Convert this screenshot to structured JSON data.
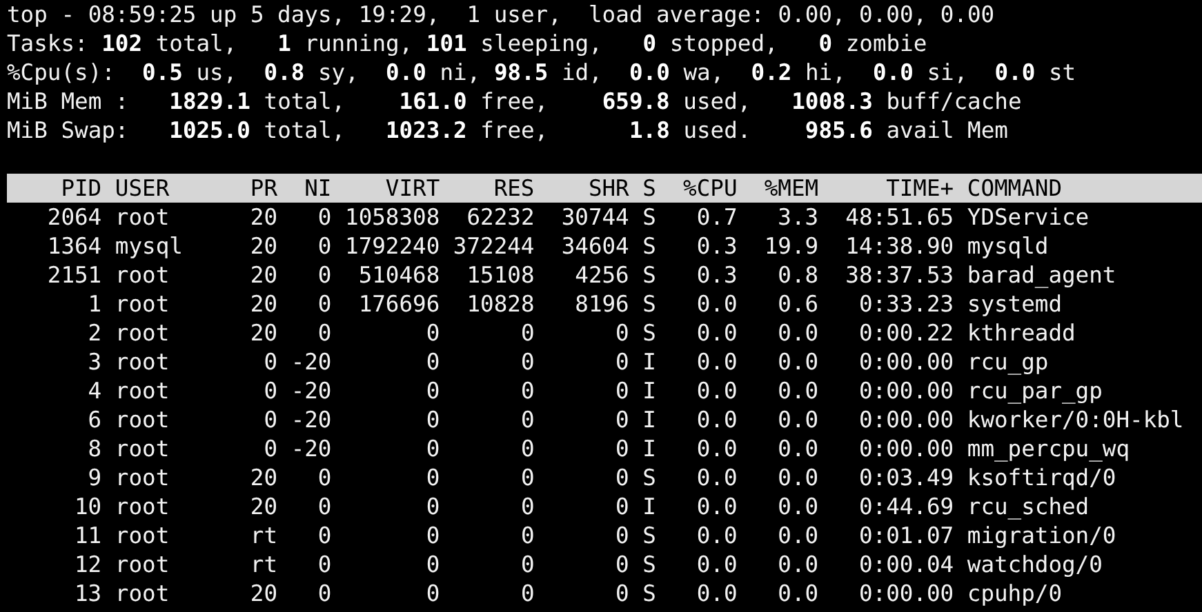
{
  "summary_lines": [
    "top - 08:59:25 up 5 days, 19:29,  1 user,  load average: 0.00, 0.00, 0.00",
    "Tasks: **102** total,   **1** running, **101** sleeping,   **0** stopped,   **0** zombie",
    "%Cpu(s):  **0.5** us,  **0.8** sy,  **0.0** ni, **98.5** id,  **0.0** wa,  **0.2** hi,  **0.0** si,  **0.0** st",
    "MiB Mem :   **1829.1** total,    **161.0** free,    **659.8** used,   **1008.3** buff/cache",
    "MiB Swap:   **1025.0** total,   **1023.2** free,      **1.8** used.    **985.6** avail Mem"
  ],
  "table": {
    "columns": [
      "PID",
      "USER",
      "PR",
      "NI",
      "VIRT",
      "RES",
      "SHR",
      "S",
      "%CPU",
      "%MEM",
      "TIME+",
      "COMMAND"
    ],
    "rows": [
      [
        "2064",
        "root",
        "20",
        "0",
        "1058308",
        "62232",
        "30744",
        "S",
        "0.7",
        "3.3",
        "48:51.65",
        "YDService"
      ],
      [
        "1364",
        "mysql",
        "20",
        "0",
        "1792240",
        "372244",
        "34604",
        "S",
        "0.3",
        "19.9",
        "14:38.90",
        "mysqld"
      ],
      [
        "2151",
        "root",
        "20",
        "0",
        "510468",
        "15108",
        "4256",
        "S",
        "0.3",
        "0.8",
        "38:37.53",
        "barad_agent"
      ],
      [
        "1",
        "root",
        "20",
        "0",
        "176696",
        "10828",
        "8196",
        "S",
        "0.0",
        "0.6",
        "0:33.23",
        "systemd"
      ],
      [
        "2",
        "root",
        "20",
        "0",
        "0",
        "0",
        "0",
        "S",
        "0.0",
        "0.0",
        "0:00.22",
        "kthreadd"
      ],
      [
        "3",
        "root",
        "0",
        "-20",
        "0",
        "0",
        "0",
        "I",
        "0.0",
        "0.0",
        "0:00.00",
        "rcu_gp"
      ],
      [
        "4",
        "root",
        "0",
        "-20",
        "0",
        "0",
        "0",
        "I",
        "0.0",
        "0.0",
        "0:00.00",
        "rcu_par_gp"
      ],
      [
        "6",
        "root",
        "0",
        "-20",
        "0",
        "0",
        "0",
        "I",
        "0.0",
        "0.0",
        "0:00.00",
        "kworker/0:0H-kbl"
      ],
      [
        "8",
        "root",
        "0",
        "-20",
        "0",
        "0",
        "0",
        "I",
        "0.0",
        "0.0",
        "0:00.00",
        "mm_percpu_wq"
      ],
      [
        "9",
        "root",
        "20",
        "0",
        "0",
        "0",
        "0",
        "S",
        "0.0",
        "0.0",
        "0:03.49",
        "ksoftirqd/0"
      ],
      [
        "10",
        "root",
        "20",
        "0",
        "0",
        "0",
        "0",
        "I",
        "0.0",
        "0.0",
        "0:44.69",
        "rcu_sched"
      ],
      [
        "11",
        "root",
        "rt",
        "0",
        "0",
        "0",
        "0",
        "S",
        "0.0",
        "0.0",
        "0:01.07",
        "migration/0"
      ],
      [
        "12",
        "root",
        "rt",
        "0",
        "0",
        "0",
        "0",
        "S",
        "0.0",
        "0.0",
        "0:00.04",
        "watchdog/0"
      ],
      [
        "13",
        "root",
        "20",
        "0",
        "0",
        "0",
        "0",
        "S",
        "0.0",
        "0.0",
        "0:00.00",
        "cpuhp/0"
      ]
    ]
  }
}
